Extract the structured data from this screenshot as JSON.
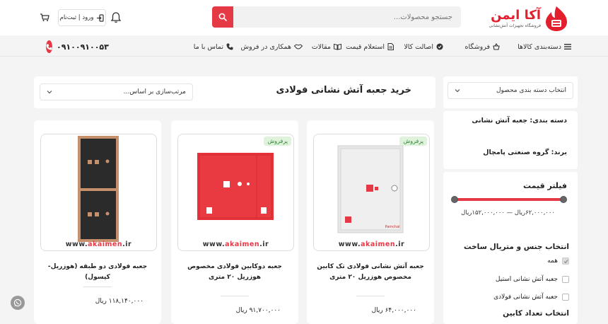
{
  "brand": {
    "name": "آکا ایمن",
    "tagline": "فروشگاه تجهیزات آتش‌نشانی"
  },
  "search": {
    "placeholder": "جستجو محصولات..."
  },
  "header": {
    "login_label": "ورود | ثبت‌نام"
  },
  "nav": {
    "categories": "دسته‌بندی کالاها",
    "shop": "فروشگاه",
    "authenticity": "اصالت کالا",
    "price_inquiry": "استعلام قیمت",
    "articles": "مقالات",
    "sales_partnership": "همکاری در فروش",
    "contact": "تماس با ما"
  },
  "phone": "۰۹۱۰۰۹۱۰۰۵۳",
  "sidebar": {
    "category_select": "انتخاب دسته بندی محصول",
    "category_label": "دسته بندی: جعبه آتش نشانی",
    "brand_label": "برند: گروه صنعتی پامچال",
    "price_filter_title": "فیلتر قیمت",
    "price_range": "۶۲,۰۰۰,۰۰۰ریال — ۱۵۲,۰۰۰,۰۰۰ریال",
    "material_title": "انتخاب جنس و متریال ساخت",
    "material_options": [
      {
        "label": "همه",
        "checked": true
      },
      {
        "label": "جعبه آتش نشانی استیل",
        "checked": false
      },
      {
        "label": "جعبه آتش نشانی فولادی",
        "checked": false
      }
    ],
    "cabinet_count_title": "انتخاب تعداد کابین"
  },
  "listing": {
    "title": "خرید جعبه آتش نشانی فولادی",
    "sort_placeholder": "مرتب‌سازی بر اساس..."
  },
  "watermark": {
    "prefix": "www.",
    "brand": "akaimen",
    "suffix": ".ir"
  },
  "products": [
    {
      "name": "جعبه آتش نشانی فولادی تک کابین مخصوص هوزریل ۲۰ متری",
      "price": "۶۴,۰۰۰,۰۰۰ ریال",
      "badge": "پرفروش",
      "image": "white-cabinet-single",
      "image_label": "Pamchal"
    },
    {
      "name": "جعبه دوکابین فولادی مخصوص هوزریل ۲۰ متری",
      "price": "۹۱,۷۰۰,۰۰۰ ریال",
      "badge": "پرفروش",
      "image": "red-cabinet-double"
    },
    {
      "name": "جعبه فولادی دو طبقه (هوزریل-کپسول)",
      "price": "۱۱۸,۱۴۰,۰۰۰ ریال",
      "badge": "",
      "image": "black-cabinet-two-tier"
    }
  ],
  "colors": {
    "accent": "#e63946",
    "badge_bg": "#dff3dc",
    "badge_text": "#2f8a36"
  }
}
